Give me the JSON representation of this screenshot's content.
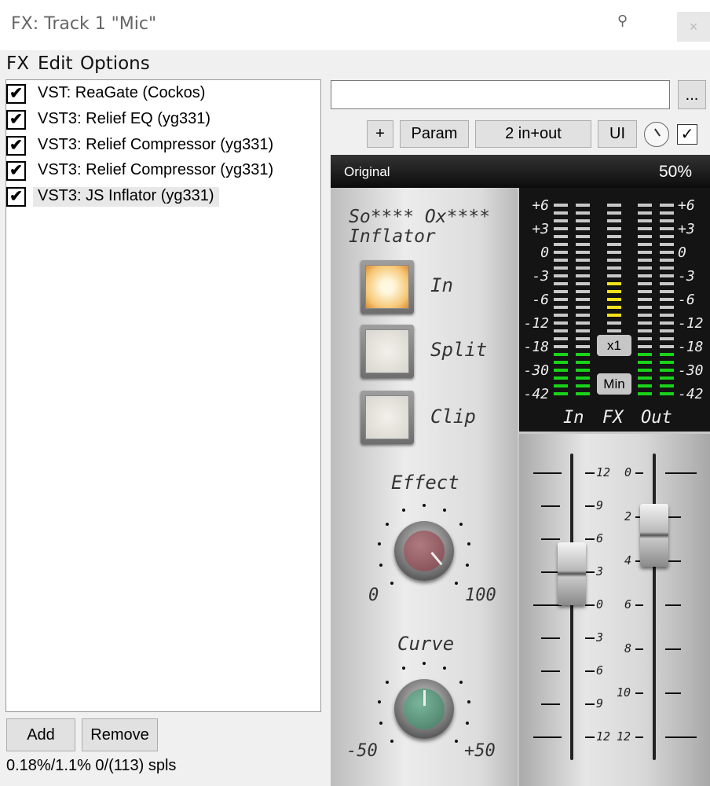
{
  "window": {
    "title": "FX: Track 1 \"Mic\"",
    "close": "×"
  },
  "menu": [
    "FX",
    "Edit",
    "Options"
  ],
  "fx_chain": [
    {
      "label": "VST: ReaGate (Cockos)",
      "checked": true
    },
    {
      "label": "VST3: Relief EQ (yg331)",
      "checked": true
    },
    {
      "label": "VST3: Relief Compressor (yg331)",
      "checked": true
    },
    {
      "label": "VST3: Relief Compressor (yg331)",
      "checked": true
    },
    {
      "label": "VST3: JS Inflator (yg331)",
      "checked": true,
      "selected": true
    }
  ],
  "buttons": {
    "add": "Add",
    "remove": "Remove",
    "more": "...",
    "plus": "+",
    "param": "Param",
    "io": "2 in+out",
    "ui": "UI"
  },
  "status": "0.18%/1.1% 0/(113) spls",
  "preset": {
    "value": ""
  },
  "plugin": {
    "header_left": "Original",
    "header_right": "50%",
    "brand_line1": "So**** Ox****",
    "brand_line2": "Inflator",
    "switches": {
      "in": "In",
      "split": "Split",
      "clip": "Clip"
    },
    "effect": {
      "label": "Effect",
      "min": "0",
      "max": "100"
    },
    "curve": {
      "label": "Curve",
      "min": "-50",
      "max": "+50"
    },
    "meter_scale": [
      "+6",
      "+3",
      "0",
      "-3",
      "-6",
      "-12",
      "-18",
      "-30",
      "-42"
    ],
    "meter_labels": {
      "in": "In",
      "fx": "FX",
      "out": "Out"
    },
    "meter_buttons": {
      "x1": "x1",
      "min": "Min"
    },
    "in_fader_scale": [
      "12",
      "9",
      "6",
      "3",
      "0",
      "3",
      "6",
      "9",
      "12"
    ],
    "out_fader_scale": [
      "0",
      "2",
      "4",
      "6",
      "8",
      "10",
      "12"
    ],
    "colors": {
      "meter_green": "#19d319",
      "meter_yellow": "#f5e21a",
      "meter_off": "#c8c8c8"
    }
  }
}
